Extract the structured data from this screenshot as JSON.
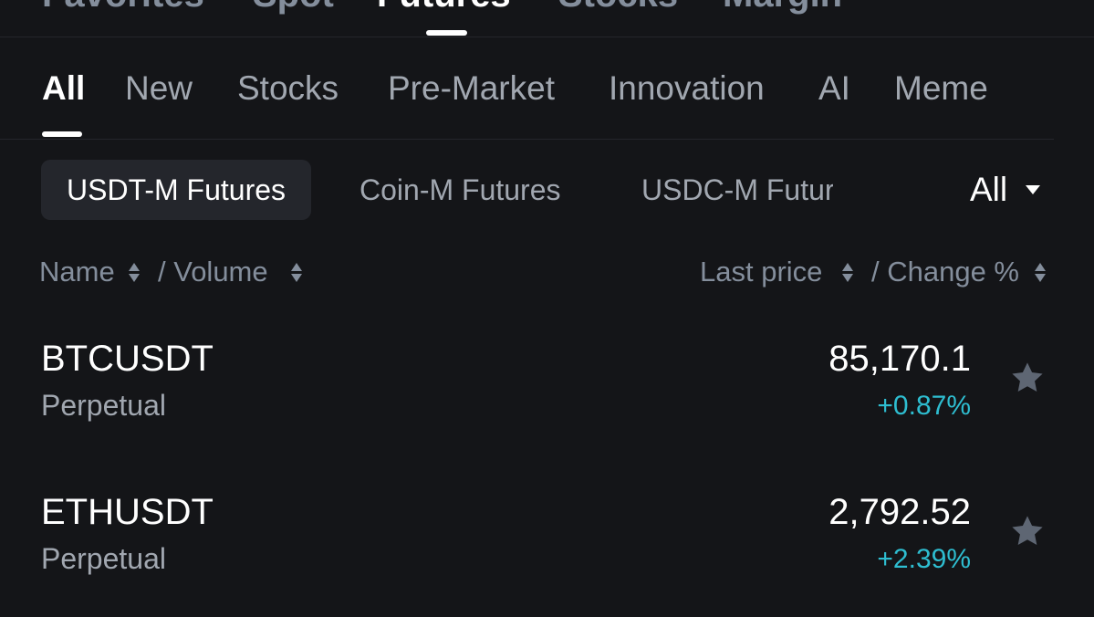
{
  "top_tabs": [
    {
      "label": "Favorites"
    },
    {
      "label": "Spot"
    },
    {
      "label": "Futures",
      "active": true
    },
    {
      "label": "Stocks"
    },
    {
      "label": "Margin"
    }
  ],
  "categories": [
    {
      "label": "All",
      "active": true
    },
    {
      "label": "New"
    },
    {
      "label": "Stocks"
    },
    {
      "label": "Pre-Market"
    },
    {
      "label": "Innovation"
    },
    {
      "label": "AI"
    },
    {
      "label": "Meme"
    }
  ],
  "futures_types": [
    {
      "label": "USDT-M Futures",
      "active": true
    },
    {
      "label": "Coin-M Futures"
    },
    {
      "label": "USDC-M Futures"
    }
  ],
  "filter": {
    "label": "All"
  },
  "columns": {
    "name": "Name",
    "volume": "/ Volume",
    "last_price": "Last price",
    "change": "/ Change %"
  },
  "rows": [
    {
      "symbol": "BTCUSDT",
      "type": "Perpetual",
      "price": "85,170.1",
      "change": "+0.87%"
    },
    {
      "symbol": "ETHUSDT",
      "type": "Perpetual",
      "price": "2,792.52",
      "change": "+2.39%"
    }
  ],
  "colors": {
    "background": "#141518",
    "positive": "#2ebdd0",
    "star": "#5e6673",
    "chip_active_bg": "#24262c"
  },
  "icons": [
    "sort-icon",
    "caret-down-icon",
    "star-icon"
  ]
}
